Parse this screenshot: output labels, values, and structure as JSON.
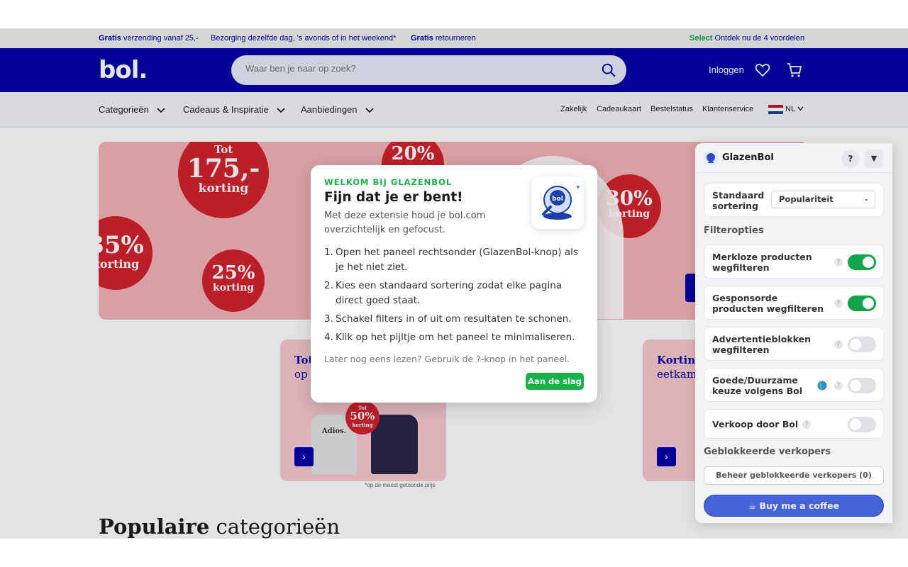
{
  "topbar": {
    "shipping_bold": "Gratis",
    "shipping_text": " verzending vanaf 25,-",
    "delivery": "Bezorging dezelfde dag, 's avonds of in het weekend*",
    "returns_bold": "Gratis",
    "returns_text": " retourneren",
    "select_bold": "Select",
    "select_text": " Ontdek nu de 4 voordelen"
  },
  "header": {
    "logo": "bol.",
    "search_placeholder": "Waar ben je naar op zoek?",
    "login": "Inloggen"
  },
  "nav": {
    "categories": [
      "Categorieën",
      "Cadeaus & Inspiratie",
      "Aanbiedingen"
    ],
    "links": [
      "Zakelijk",
      "Cadeaukaart",
      "Bestelstatus",
      "Klantenservice"
    ],
    "language": "NL"
  },
  "hero": {
    "bubbles": [
      {
        "top": "Tot",
        "value": "175,-",
        "bottom": "korting"
      },
      {
        "value": "20%"
      },
      {
        "value": "35%",
        "bottom": "korting"
      },
      {
        "value": "25%",
        "bottom": "korting"
      },
      {
        "value": "30%",
        "bottom": "korting"
      }
    ]
  },
  "cards": [
    {
      "title": "Tot",
      "subtitle": "op",
      "badge_top": "Tot",
      "badge_value": "50%",
      "badge_bottom": "korting",
      "shirt_text": "Adios."
    },
    {
      "title": "Korting",
      "subtitle": "eetkam"
    }
  ],
  "footnote": "*op de meest getoonde prijs",
  "popular": {
    "bold": "Populaire",
    "rest": " categorieën"
  },
  "modal": {
    "eyebrow": "WELKOM BIJ GLAZENBOL",
    "title": "Fijn dat je er bent!",
    "intro": "Met deze extensie houd je bol.com overzichtelijk en gefocust.",
    "logo_text": "bol",
    "steps": [
      "Open het paneel rechtsonder (GlazenBol-knop) als je het niet ziet.",
      "Kies een standaard sortering zodat elke pagina direct goed staat.",
      "Schakel filters in of uit om resultaten te schonen.",
      "Klik op het pijltje om het paneel te minimaliseren."
    ],
    "later": "Later nog eens lezen? Gebruik de ?-knop in het paneel.",
    "button": "Aan de slag"
  },
  "panel": {
    "title": "GlazenBol",
    "help": "?",
    "minimize": "▼",
    "sort_label": "Standaard sortering",
    "sort_value": "Populariteit",
    "filters_heading": "Filteropties",
    "filters": [
      {
        "label": "Merkloze producten wegfilteren",
        "on": true
      },
      {
        "label": "Gesponsorde producten wegfilteren",
        "on": true
      },
      {
        "label": "Advertentieblokken wegfilteren",
        "on": false
      },
      {
        "label": "Goede/Duurzame keuze volgens Bol",
        "on": false
      },
      {
        "label": "Verkoop door Bol",
        "on": false
      }
    ],
    "blocked_heading": "Geblokkeerde verkopers",
    "manage_button": "Beheer geblokkeerde verkopers (0)",
    "coffee_button": "☕ Buy me a coffee"
  },
  "colors": {
    "brand": "#0000a4",
    "green": "#19b248",
    "hero_bg": "#f4b2b6",
    "bubble": "#d32027"
  }
}
